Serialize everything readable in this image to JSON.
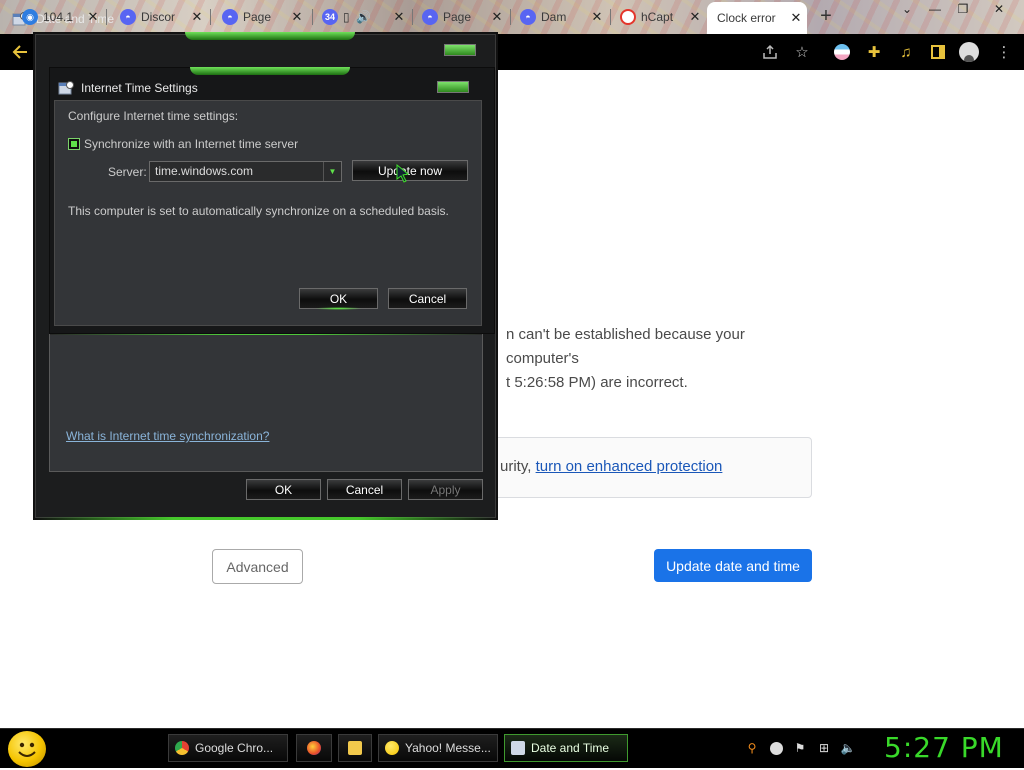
{
  "browser": {
    "tabs": [
      {
        "title": "104.1",
        "favicon_color": "#2e7de0",
        "icon": "location-icon"
      },
      {
        "title": "Discor",
        "favicon_color": "#5865f2",
        "icon": "discord-icon"
      },
      {
        "title": "Page",
        "favicon_color": "#5865f2",
        "icon": "discord-icon"
      },
      {
        "title": "",
        "favicon_color": "#5865f2",
        "icon": "discord-icon",
        "badge": "34"
      },
      {
        "title": "Page",
        "favicon_color": "#5865f2",
        "icon": "discord-icon"
      },
      {
        "title": "Dam",
        "favicon_color": "#5865f2",
        "icon": "discord-icon"
      },
      {
        "title": "hCapt",
        "favicon_color": "#e4352b",
        "icon": "hcaptcha-icon"
      },
      {
        "title": "Clock error",
        "favicon_color": "",
        "icon": "",
        "active": true
      }
    ],
    "new_tab": "+",
    "window_controls": {
      "minimize": "—",
      "restore": "❐",
      "close": "✕"
    }
  },
  "page": {
    "error_line_1": "n can't be established because your computer's",
    "error_line_2": "t 5:26:58 PM) are incorrect.",
    "enhanced_prefix": "urity,",
    "enhanced_link": "turn on enhanced protection",
    "advanced_button": "Advanced",
    "update_button": "Update date and time"
  },
  "date_time_dialog": {
    "title": "Date and Time",
    "help_link": "What is Internet time synchronization?",
    "ok": "OK",
    "cancel": "Cancel",
    "apply": "Apply"
  },
  "internet_time_dialog": {
    "title": "Internet Time Settings",
    "configure_label": "Configure Internet time settings:",
    "sync_label": "Synchronize with an Internet time server",
    "sync_checked": true,
    "server_label": "Server:",
    "server_value": "time.windows.com",
    "update_now": "Update now",
    "status_text": "This computer is set to automatically synchronize on a scheduled basis.",
    "ok": "OK",
    "cancel": "Cancel"
  },
  "taskbar": {
    "buttons": [
      {
        "label": "Google Chro...",
        "icon": "chrome-icon"
      },
      {
        "label": "",
        "icon": "firefox-icon"
      },
      {
        "label": "",
        "icon": "folder-icon"
      },
      {
        "label": "Yahoo! Messe...",
        "icon": "yahoo-messenger-icon"
      },
      {
        "label": "Date and Time",
        "icon": "date-time-icon",
        "active": true
      }
    ],
    "clock": "5:27 PM"
  },
  "colors": {
    "accent_green": "#39d92a",
    "link_blue": "#1a57b8",
    "primary_button": "#1a73e8"
  }
}
